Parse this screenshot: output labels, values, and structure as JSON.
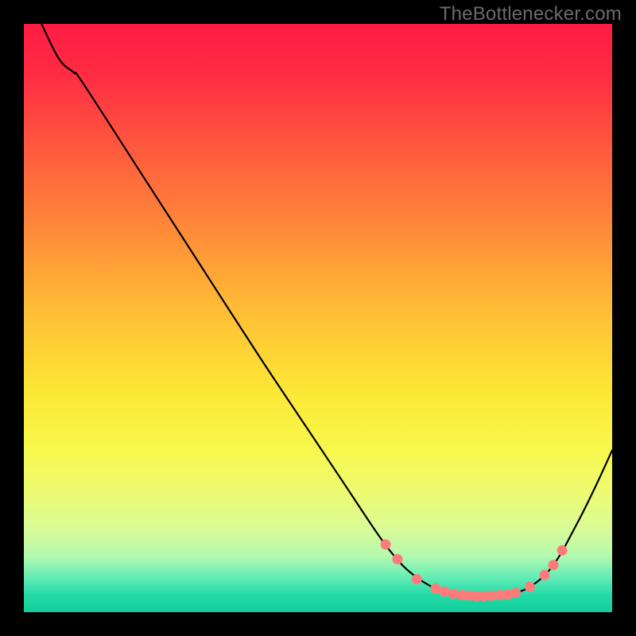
{
  "watermark": "TheBottlenecker.com",
  "chart_data": {
    "type": "line",
    "title": "",
    "xlabel": "",
    "ylabel": "",
    "xlim": [
      0,
      100
    ],
    "ylim": [
      0,
      100
    ],
    "grid": false,
    "background_gradient": {
      "stops": [
        {
          "offset": 0.0,
          "color": "#ff1c44"
        },
        {
          "offset": 0.08,
          "color": "#ff2a43"
        },
        {
          "offset": 0.2,
          "color": "#ff553e"
        },
        {
          "offset": 0.35,
          "color": "#ff8a39"
        },
        {
          "offset": 0.5,
          "color": "#ffc235"
        },
        {
          "offset": 0.62,
          "color": "#fce635"
        },
        {
          "offset": 0.72,
          "color": "#f8f84a"
        },
        {
          "offset": 0.8,
          "color": "#edfb75"
        },
        {
          "offset": 0.86,
          "color": "#d8fb97"
        },
        {
          "offset": 0.905,
          "color": "#b3f9b0"
        },
        {
          "offset": 0.94,
          "color": "#66edb6"
        },
        {
          "offset": 0.97,
          "color": "#25dba8"
        },
        {
          "offset": 1.0,
          "color": "#0fcf9b"
        }
      ]
    },
    "curve": [
      {
        "x": 3.0,
        "y": 100.0
      },
      {
        "x": 6.0,
        "y": 94.0
      },
      {
        "x": 8.5,
        "y": 91.7
      },
      {
        "x": 10.0,
        "y": 90.0
      },
      {
        "x": 20.0,
        "y": 74.5
      },
      {
        "x": 30.0,
        "y": 59.0
      },
      {
        "x": 40.0,
        "y": 43.5
      },
      {
        "x": 50.0,
        "y": 28.5
      },
      {
        "x": 55.0,
        "y": 21.0
      },
      {
        "x": 60.0,
        "y": 13.5
      },
      {
        "x": 63.0,
        "y": 9.5
      },
      {
        "x": 66.0,
        "y": 6.5
      },
      {
        "x": 70.0,
        "y": 4.0
      },
      {
        "x": 74.0,
        "y": 3.0
      },
      {
        "x": 78.0,
        "y": 2.7
      },
      {
        "x": 82.0,
        "y": 3.0
      },
      {
        "x": 86.0,
        "y": 4.3
      },
      {
        "x": 90.0,
        "y": 8.0
      },
      {
        "x": 94.0,
        "y": 15.0
      },
      {
        "x": 97.0,
        "y": 21.0
      },
      {
        "x": 100.0,
        "y": 27.5
      }
    ],
    "markers": [
      {
        "x": 61.5,
        "y": 11.5
      },
      {
        "x": 63.5,
        "y": 9.0
      },
      {
        "x": 66.8,
        "y": 5.6
      },
      {
        "x": 70.0,
        "y": 4.0
      },
      {
        "x": 71.5,
        "y": 3.5
      },
      {
        "x": 73.0,
        "y": 3.1
      },
      {
        "x": 74.5,
        "y": 2.9
      },
      {
        "x": 75.8,
        "y": 2.8
      },
      {
        "x": 77.0,
        "y": 2.7
      },
      {
        "x": 78.2,
        "y": 2.7
      },
      {
        "x": 79.5,
        "y": 2.8
      },
      {
        "x": 81.0,
        "y": 2.9
      },
      {
        "x": 82.3,
        "y": 3.0
      },
      {
        "x": 83.6,
        "y": 3.3
      },
      {
        "x": 86.0,
        "y": 4.3
      },
      {
        "x": 88.5,
        "y": 6.3
      },
      {
        "x": 90.0,
        "y": 8.0
      },
      {
        "x": 91.5,
        "y": 10.5
      }
    ],
    "marker_style": {
      "color": "#ff7b7b",
      "radius": 6.5
    },
    "line_style": {
      "color": "#000000",
      "width": 2.2
    }
  }
}
